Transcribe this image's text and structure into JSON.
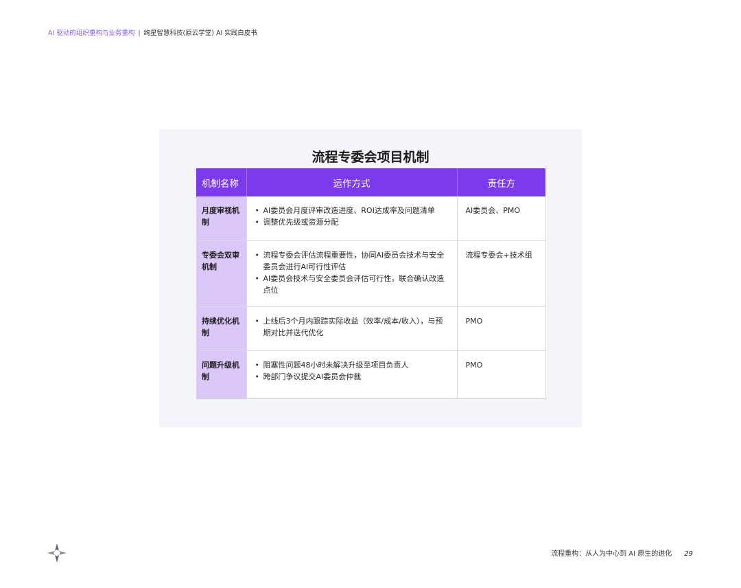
{
  "header": {
    "section": "AI 驱动的组织重构与业务重构",
    "separator": "|",
    "org": "绚星智慧科技(原云学堂) AI 实践白皮书"
  },
  "figure": {
    "title": "流程专委会项目机制",
    "columns": [
      "机制名称",
      "运作方式",
      "责任方"
    ],
    "rows": [
      {
        "name": "月度审视机制",
        "points": [
          "AI委员会月度评审改造进度、ROI达成率及问题清单",
          "调整优先级或资源分配"
        ],
        "owner": "AI委员会、PMO"
      },
      {
        "name": "专委会双审机制",
        "points": [
          "流程专委会评估流程重要性，协同AI委员会技术与安全委员会进行AI可行性评估",
          "AI委员会技术与安全委员会评估可行性，联合确认改造点位"
        ],
        "owner": "流程专委会+技术组"
      },
      {
        "name": "持续优化机制",
        "points": [
          "上线后3个月内跟踪实际收益（效率/成本/收入），与预期对比并迭代优化"
        ],
        "owner": "PMO"
      },
      {
        "name": "问题升级机制",
        "points": [
          "阻塞性问题48小时未解决升级至项目负责人",
          "跨部门争议提交AI委员会仲裁"
        ],
        "owner": "PMO"
      }
    ]
  },
  "footer": {
    "chapter": "流程重构：从人为中心到 AI 原生的进化",
    "page": "29"
  },
  "icons": {
    "logo": "star-logo-icon"
  },
  "colors": {
    "accent": "#7c3aed",
    "name_cell": "#dcc8f8",
    "panel": "#f4f4fb",
    "header_accent": "#8a5cf0"
  }
}
